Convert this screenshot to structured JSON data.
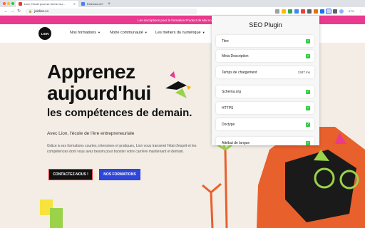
{
  "browser": {
    "tabs": [
      {
        "title": "Lion, l'école pour se former au...",
        "active": true
      },
      {
        "title": "Extensions",
        "active": false
      }
    ],
    "url": "joinlion.co",
    "zoom": "67%",
    "accent": "#4c7ef0"
  },
  "site": {
    "banner": "Les inscriptions pour la formation Product de Mai sont ouvertes",
    "banner_color": "#ea3a8f",
    "logo": "LION",
    "nav": [
      {
        "label": "Nos formations"
      },
      {
        "label": "Notre communauté"
      },
      {
        "label": "Les métiers du numérique"
      }
    ],
    "hero": {
      "title_line1": "Apprenez",
      "title_line2": "aujourd'hui",
      "subtitle": "les compétences de demain.",
      "lead": "Avec Lion, l'école de l'ère entrepreneuriale",
      "desc": "Grâce à ses formations courtes, intensives et pratiques, Lion vous transmet l'état d'esprit et les compétences dont vous avez besoin pour booster votre carrière maintenant et demain.",
      "cta_contact": "CONTACTEZ-NOUS !",
      "cta_formations": "NOS FORMATIONS"
    }
  },
  "seo_plugin": {
    "title": "SEO Plugin",
    "items": [
      {
        "label": "Titre",
        "status": "check"
      },
      {
        "label": "Meta Description",
        "status": "check"
      },
      {
        "label": "Temps de chargement",
        "value": "1347 ms"
      },
      {
        "label": "Schema.org",
        "status": "check"
      },
      {
        "label": "HTTPS",
        "status": "check"
      },
      {
        "label": "Doctype",
        "status": "check"
      },
      {
        "label": "Attribut de langue",
        "status": "check"
      }
    ],
    "check_color": "#2ecc40"
  }
}
